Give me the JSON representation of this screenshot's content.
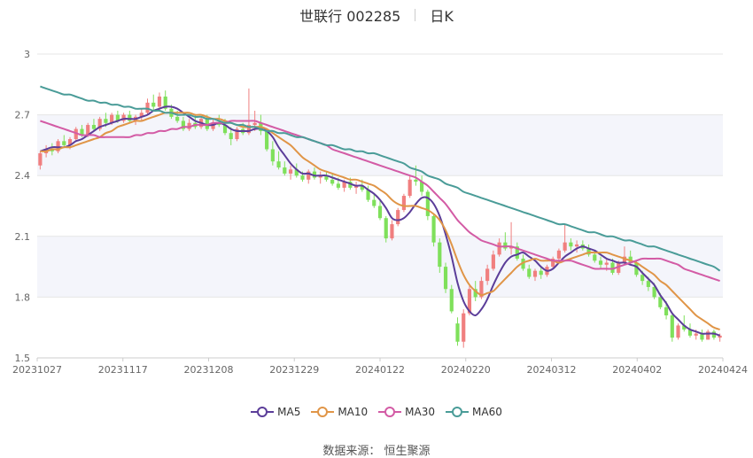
{
  "header": {
    "stock": "世联行 002285",
    "period": "日K"
  },
  "source": "数据来源：  恒生聚源",
  "chart_data": {
    "type": "candlestick",
    "title": "世联行 002285",
    "subtitle": "日K",
    "ylim": [
      1.5,
      3.0
    ],
    "y_ticks": [
      "1.5",
      "1.8",
      "2.1",
      "2.4",
      "2.7",
      "3"
    ],
    "x_ticks": [
      "20231027",
      "20231117",
      "20231208",
      "20231229",
      "20240122",
      "20240220",
      "20240312",
      "20240402",
      "20240424"
    ],
    "legend_position": "bottom",
    "colors": {
      "up": "#f07f7f",
      "down": "#7fe05b",
      "MA5": "#5b3d99",
      "MA10": "#e09547",
      "MA30": "#d35ba5",
      "MA60": "#4a9c98",
      "band": "#f4f5fb",
      "grid": "#e6e6e6"
    },
    "ohlc": [
      [
        2.45,
        2.52,
        2.43,
        2.51
      ],
      [
        2.51,
        2.55,
        2.49,
        2.53
      ],
      [
        2.53,
        2.56,
        2.5,
        2.52
      ],
      [
        2.52,
        2.58,
        2.51,
        2.57
      ],
      [
        2.57,
        2.6,
        2.54,
        2.55
      ],
      [
        2.55,
        2.59,
        2.53,
        2.58
      ],
      [
        2.58,
        2.64,
        2.57,
        2.63
      ],
      [
        2.63,
        2.65,
        2.59,
        2.6
      ],
      [
        2.6,
        2.66,
        2.59,
        2.65
      ],
      [
        2.65,
        2.68,
        2.62,
        2.63
      ],
      [
        2.63,
        2.69,
        2.62,
        2.68
      ],
      [
        2.68,
        2.71,
        2.64,
        2.66
      ],
      [
        2.66,
        2.71,
        2.65,
        2.7
      ],
      [
        2.7,
        2.72,
        2.66,
        2.67
      ],
      [
        2.67,
        2.71,
        2.66,
        2.7
      ],
      [
        2.7,
        2.72,
        2.66,
        2.67
      ],
      [
        2.67,
        2.7,
        2.65,
        2.69
      ],
      [
        2.69,
        2.73,
        2.67,
        2.71
      ],
      [
        2.71,
        2.78,
        2.7,
        2.76
      ],
      [
        2.76,
        2.8,
        2.72,
        2.74
      ],
      [
        2.74,
        2.81,
        2.72,
        2.79
      ],
      [
        2.79,
        2.82,
        2.72,
        2.73
      ],
      [
        2.73,
        2.75,
        2.68,
        2.69
      ],
      [
        2.69,
        2.72,
        2.66,
        2.67
      ],
      [
        2.67,
        2.69,
        2.62,
        2.63
      ],
      [
        2.63,
        2.68,
        2.62,
        2.66
      ],
      [
        2.66,
        2.7,
        2.63,
        2.64
      ],
      [
        2.64,
        2.69,
        2.63,
        2.68
      ],
      [
        2.68,
        2.7,
        2.62,
        2.63
      ],
      [
        2.63,
        2.68,
        2.62,
        2.66
      ],
      [
        2.66,
        2.7,
        2.64,
        2.65
      ],
      [
        2.65,
        2.68,
        2.6,
        2.61
      ],
      [
        2.61,
        2.64,
        2.55,
        2.58
      ],
      [
        2.58,
        2.64,
        2.57,
        2.63
      ],
      [
        2.63,
        2.66,
        2.6,
        2.61
      ],
      [
        2.61,
        2.83,
        2.6,
        2.65
      ],
      [
        2.65,
        2.72,
        2.62,
        2.66
      ],
      [
        2.66,
        2.7,
        2.6,
        2.62
      ],
      [
        2.62,
        2.63,
        2.52,
        2.53
      ],
      [
        2.53,
        2.57,
        2.45,
        2.47
      ],
      [
        2.47,
        2.52,
        2.43,
        2.44
      ],
      [
        2.44,
        2.47,
        2.4,
        2.41
      ],
      [
        2.41,
        2.45,
        2.38,
        2.43
      ],
      [
        2.43,
        2.46,
        2.39,
        2.4
      ],
      [
        2.4,
        2.42,
        2.37,
        2.38
      ],
      [
        2.38,
        2.43,
        2.36,
        2.42
      ],
      [
        2.42,
        2.44,
        2.38,
        2.39
      ],
      [
        2.39,
        2.42,
        2.36,
        2.4
      ],
      [
        2.4,
        2.42,
        2.37,
        2.38
      ],
      [
        2.38,
        2.41,
        2.35,
        2.36
      ],
      [
        2.36,
        2.39,
        2.33,
        2.34
      ],
      [
        2.34,
        2.38,
        2.32,
        2.37
      ],
      [
        2.37,
        2.39,
        2.33,
        2.34
      ],
      [
        2.34,
        2.37,
        2.31,
        2.35
      ],
      [
        2.35,
        2.38,
        2.32,
        2.33
      ],
      [
        2.33,
        2.35,
        2.27,
        2.28
      ],
      [
        2.28,
        2.31,
        2.24,
        2.25
      ],
      [
        2.25,
        2.28,
        2.18,
        2.19
      ],
      [
        2.19,
        2.2,
        2.07,
        2.09
      ],
      [
        2.09,
        2.18,
        2.08,
        2.16
      ],
      [
        2.16,
        2.24,
        2.15,
        2.23
      ],
      [
        2.23,
        2.31,
        2.22,
        2.3
      ],
      [
        2.3,
        2.4,
        2.29,
        2.38
      ],
      [
        2.38,
        2.45,
        2.35,
        2.37
      ],
      [
        2.37,
        2.4,
        2.3,
        2.32
      ],
      [
        2.32,
        2.33,
        2.18,
        2.2
      ],
      [
        2.2,
        2.21,
        2.05,
        2.07
      ],
      [
        2.07,
        2.09,
        1.92,
        1.95
      ],
      [
        1.95,
        1.97,
        1.82,
        1.84
      ],
      [
        1.84,
        1.86,
        1.72,
        1.73
      ],
      [
        1.67,
        1.7,
        1.56,
        1.58
      ],
      [
        1.58,
        1.74,
        1.55,
        1.72
      ],
      [
        1.72,
        1.86,
        1.71,
        1.84
      ],
      [
        1.84,
        1.88,
        1.78,
        1.8
      ],
      [
        1.8,
        1.9,
        1.79,
        1.88
      ],
      [
        1.88,
        1.96,
        1.86,
        1.94
      ],
      [
        1.94,
        2.03,
        1.93,
        2.01
      ],
      [
        2.01,
        2.09,
        2.0,
        2.07
      ],
      [
        2.07,
        2.12,
        2.03,
        2.04
      ],
      [
        2.04,
        2.17,
        2.01,
        2.05
      ],
      [
        2.05,
        2.07,
        1.98,
        1.99
      ],
      [
        1.99,
        2.01,
        1.93,
        1.94
      ],
      [
        1.94,
        1.96,
        1.89,
        1.9
      ],
      [
        1.9,
        1.94,
        1.88,
        1.93
      ],
      [
        1.93,
        1.95,
        1.89,
        1.91
      ],
      [
        1.91,
        1.96,
        1.9,
        1.95
      ],
      [
        1.95,
        2.0,
        1.94,
        1.99
      ],
      [
        1.99,
        2.04,
        1.97,
        2.03
      ],
      [
        2.03,
        2.16,
        2.02,
        2.07
      ],
      [
        2.07,
        2.09,
        2.03,
        2.05
      ],
      [
        2.05,
        2.08,
        2.02,
        2.06
      ],
      [
        2.06,
        2.08,
        2.03,
        2.04
      ],
      [
        2.04,
        2.06,
        2.0,
        2.01
      ],
      [
        2.01,
        2.03,
        1.97,
        1.98
      ],
      [
        1.98,
        2.0,
        1.94,
        1.96
      ],
      [
        1.96,
        1.99,
        1.93,
        1.97
      ],
      [
        1.97,
        1.99,
        1.91,
        1.92
      ],
      [
        1.92,
        1.98,
        1.91,
        1.97
      ],
      [
        1.97,
        2.05,
        1.96,
        2.0
      ],
      [
        2.0,
        2.03,
        1.96,
        1.97
      ],
      [
        1.97,
        1.98,
        1.9,
        1.91
      ],
      [
        1.91,
        1.93,
        1.86,
        1.88
      ],
      [
        1.88,
        1.9,
        1.83,
        1.85
      ],
      [
        1.85,
        1.87,
        1.79,
        1.8
      ],
      [
        1.8,
        1.82,
        1.74,
        1.75
      ],
      [
        1.75,
        1.78,
        1.69,
        1.71
      ],
      [
        1.71,
        1.72,
        1.58,
        1.6
      ],
      [
        1.6,
        1.67,
        1.59,
        1.66
      ],
      [
        1.66,
        1.71,
        1.63,
        1.64
      ],
      [
        1.64,
        1.67,
        1.6,
        1.61
      ],
      [
        1.61,
        1.64,
        1.59,
        1.62
      ],
      [
        1.62,
        1.64,
        1.58,
        1.59
      ],
      [
        1.59,
        1.64,
        1.59,
        1.63
      ],
      [
        1.63,
        1.64,
        1.59,
        1.6
      ],
      [
        1.6,
        1.62,
        1.58,
        1.61
      ]
    ],
    "series": [
      {
        "name": "MA5",
        "values": [
          2.52,
          2.53,
          2.54,
          2.54,
          2.54,
          2.55,
          2.57,
          2.58,
          2.6,
          2.62,
          2.64,
          2.65,
          2.66,
          2.67,
          2.68,
          2.68,
          2.68,
          2.69,
          2.7,
          2.72,
          2.73,
          2.74,
          2.74,
          2.73,
          2.71,
          2.69,
          2.67,
          2.66,
          2.65,
          2.65,
          2.66,
          2.65,
          2.63,
          2.62,
          2.62,
          2.62,
          2.63,
          2.63,
          2.62,
          2.59,
          2.54,
          2.5,
          2.46,
          2.43,
          2.41,
          2.41,
          2.4,
          2.4,
          2.4,
          2.39,
          2.38,
          2.37,
          2.36,
          2.35,
          2.35,
          2.33,
          2.31,
          2.28,
          2.24,
          2.19,
          2.18,
          2.19,
          2.22,
          2.26,
          2.29,
          2.29,
          2.26,
          2.2,
          2.11,
          2.0,
          1.87,
          1.78,
          1.73,
          1.71,
          1.74,
          1.79,
          1.86,
          1.92,
          1.97,
          2.0,
          2.01,
          2.02,
          2.0,
          1.98,
          1.95,
          1.93,
          1.94,
          1.97,
          2.0,
          2.02,
          2.04,
          2.05,
          2.04,
          2.03,
          2.01,
          1.99,
          1.98,
          1.97,
          1.97,
          1.96,
          1.95,
          1.92,
          1.89,
          1.86,
          1.81,
          1.77,
          1.72,
          1.69,
          1.66,
          1.64,
          1.63,
          1.62,
          1.62,
          1.62,
          1.61
        ]
      },
      {
        "name": "MA10",
        "values": [
          2.52,
          2.52,
          2.53,
          2.53,
          2.54,
          2.54,
          2.55,
          2.56,
          2.57,
          2.58,
          2.59,
          2.61,
          2.62,
          2.64,
          2.65,
          2.66,
          2.67,
          2.67,
          2.68,
          2.69,
          2.7,
          2.71,
          2.71,
          2.71,
          2.71,
          2.71,
          2.7,
          2.7,
          2.69,
          2.68,
          2.68,
          2.67,
          2.66,
          2.65,
          2.64,
          2.64,
          2.64,
          2.64,
          2.63,
          2.61,
          2.59,
          2.57,
          2.55,
          2.52,
          2.49,
          2.47,
          2.45,
          2.43,
          2.42,
          2.41,
          2.4,
          2.39,
          2.38,
          2.38,
          2.37,
          2.36,
          2.35,
          2.33,
          2.31,
          2.28,
          2.26,
          2.25,
          2.25,
          2.25,
          2.24,
          2.23,
          2.21,
          2.18,
          2.13,
          2.06,
          1.98,
          1.91,
          1.86,
          1.83,
          1.81,
          1.82,
          1.83,
          1.86,
          1.89,
          1.92,
          1.95,
          1.97,
          1.98,
          1.99,
          1.98,
          1.98,
          1.98,
          1.97,
          1.98,
          1.99,
          2.0,
          2.01,
          2.02,
          2.02,
          2.02,
          2.02,
          2.01,
          2.0,
          1.99,
          1.98,
          1.97,
          1.95,
          1.93,
          1.91,
          1.88,
          1.86,
          1.83,
          1.8,
          1.77,
          1.74,
          1.71,
          1.69,
          1.67,
          1.65,
          1.64
        ]
      },
      {
        "name": "MA30",
        "values": [
          2.67,
          2.66,
          2.65,
          2.64,
          2.63,
          2.62,
          2.61,
          2.6,
          2.6,
          2.6,
          2.59,
          2.59,
          2.59,
          2.59,
          2.59,
          2.59,
          2.6,
          2.6,
          2.61,
          2.61,
          2.62,
          2.62,
          2.63,
          2.63,
          2.64,
          2.64,
          2.65,
          2.65,
          2.65,
          2.66,
          2.66,
          2.66,
          2.67,
          2.67,
          2.67,
          2.67,
          2.67,
          2.66,
          2.65,
          2.64,
          2.63,
          2.62,
          2.61,
          2.6,
          2.59,
          2.58,
          2.57,
          2.56,
          2.55,
          2.53,
          2.52,
          2.51,
          2.5,
          2.49,
          2.48,
          2.47,
          2.46,
          2.45,
          2.44,
          2.43,
          2.42,
          2.41,
          2.4,
          2.39,
          2.37,
          2.35,
          2.32,
          2.29,
          2.26,
          2.22,
          2.18,
          2.15,
          2.12,
          2.1,
          2.08,
          2.07,
          2.06,
          2.05,
          2.05,
          2.05,
          2.04,
          2.03,
          2.02,
          2.01,
          2.0,
          1.99,
          1.98,
          1.98,
          1.98,
          1.98,
          1.97,
          1.96,
          1.95,
          1.94,
          1.94,
          1.94,
          1.94,
          1.95,
          1.96,
          1.97,
          1.98,
          1.99,
          1.99,
          1.99,
          1.99,
          1.98,
          1.97,
          1.96,
          1.94,
          1.93,
          1.92,
          1.91,
          1.9,
          1.89,
          1.88
        ]
      },
      {
        "name": "MA60",
        "values": [
          2.84,
          2.83,
          2.82,
          2.81,
          2.8,
          2.8,
          2.79,
          2.78,
          2.77,
          2.77,
          2.76,
          2.76,
          2.75,
          2.75,
          2.74,
          2.74,
          2.73,
          2.73,
          2.73,
          2.72,
          2.72,
          2.71,
          2.71,
          2.7,
          2.7,
          2.7,
          2.69,
          2.69,
          2.68,
          2.68,
          2.67,
          2.66,
          2.66,
          2.65,
          2.65,
          2.64,
          2.64,
          2.63,
          2.62,
          2.62,
          2.61,
          2.61,
          2.6,
          2.59,
          2.59,
          2.58,
          2.57,
          2.56,
          2.55,
          2.55,
          2.54,
          2.53,
          2.53,
          2.52,
          2.52,
          2.51,
          2.51,
          2.5,
          2.49,
          2.48,
          2.47,
          2.46,
          2.44,
          2.43,
          2.42,
          2.4,
          2.39,
          2.38,
          2.36,
          2.35,
          2.34,
          2.32,
          2.31,
          2.3,
          2.29,
          2.28,
          2.27,
          2.26,
          2.25,
          2.24,
          2.23,
          2.22,
          2.21,
          2.2,
          2.19,
          2.18,
          2.17,
          2.16,
          2.16,
          2.15,
          2.14,
          2.13,
          2.12,
          2.12,
          2.11,
          2.1,
          2.1,
          2.09,
          2.08,
          2.08,
          2.07,
          2.06,
          2.05,
          2.05,
          2.04,
          2.03,
          2.02,
          2.01,
          2.0,
          1.99,
          1.98,
          1.97,
          1.96,
          1.95,
          1.93
        ]
      }
    ]
  }
}
